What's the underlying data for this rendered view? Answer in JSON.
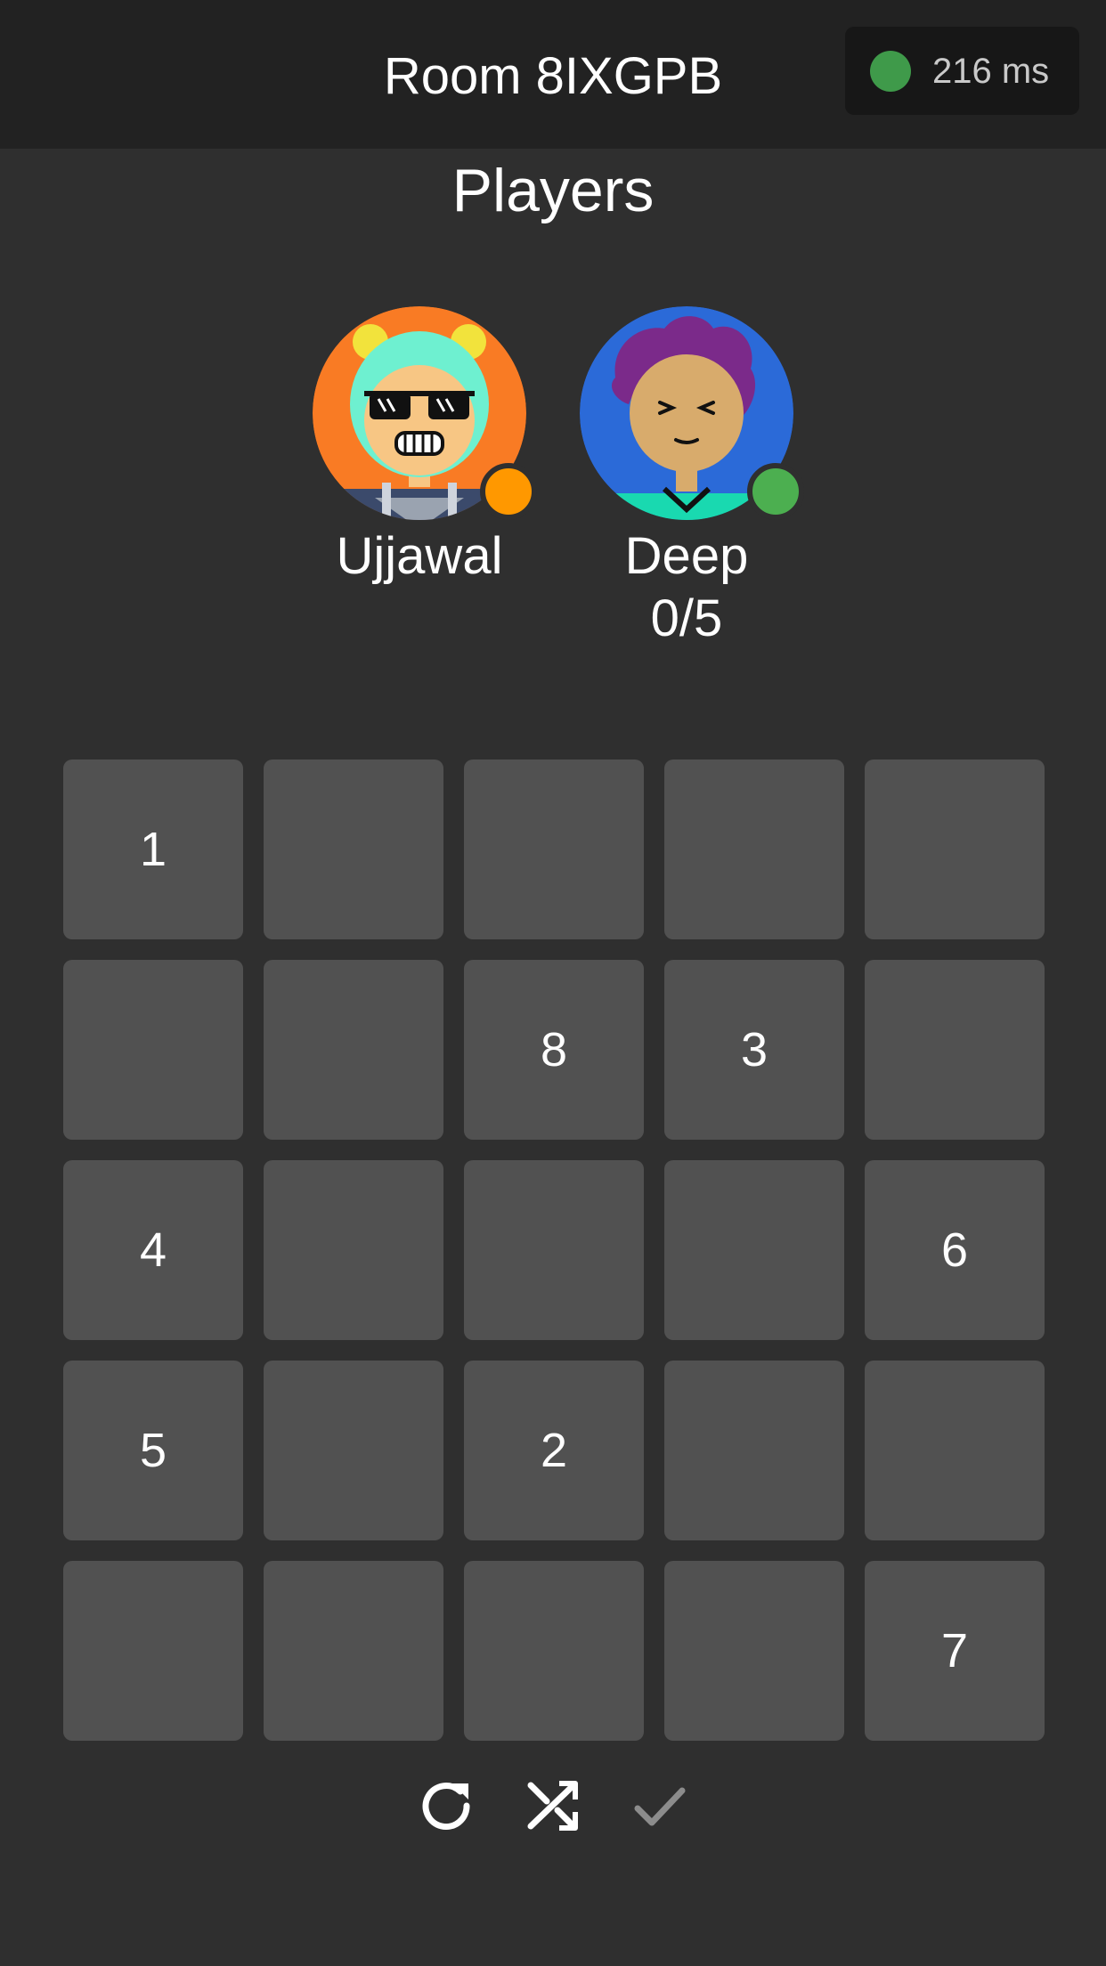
{
  "header": {
    "title": "Room 8IXGPB",
    "latency": "216 ms",
    "latency_color": "#3f9a4a"
  },
  "players": {
    "heading": "Players",
    "list": [
      {
        "name": "Ujjawal",
        "score": "",
        "avatar_bg": "#f97b24",
        "status_color": "#ff9800"
      },
      {
        "name": "Deep",
        "score": "0/5",
        "avatar_bg": "#2b6ad8",
        "status_color": "#4caf50"
      }
    ]
  },
  "board": {
    "size": 5,
    "cells": [
      "1",
      "",
      "",
      "",
      "",
      "",
      "",
      "8",
      "3",
      "",
      "4",
      "",
      "",
      "",
      "6",
      "5",
      "",
      "2",
      "",
      "",
      "",
      "",
      "",
      "",
      "7"
    ]
  },
  "controls": {
    "icons": [
      "reset-icon",
      "shuffle-icon",
      "check-icon"
    ],
    "check_enabled": false
  }
}
